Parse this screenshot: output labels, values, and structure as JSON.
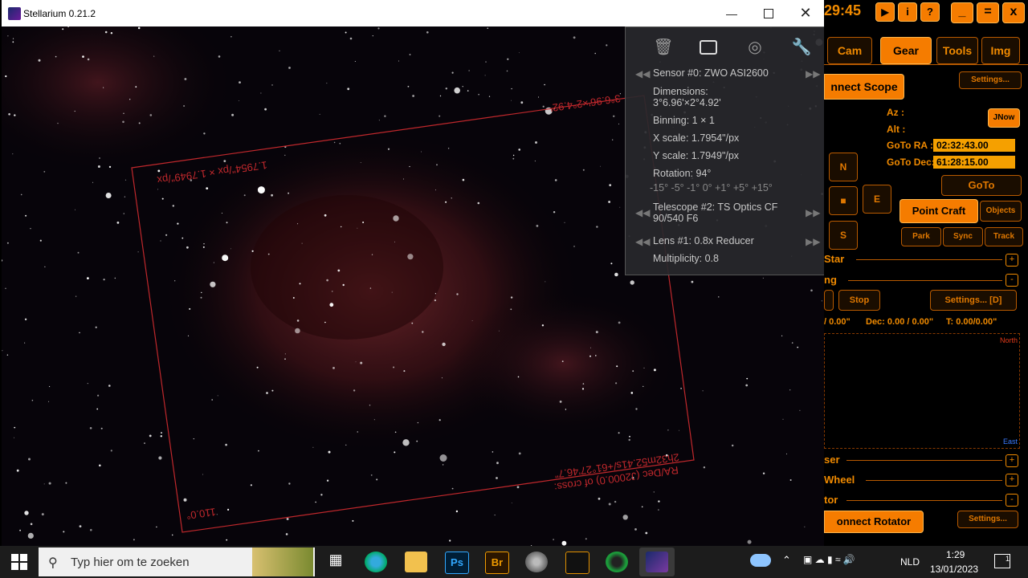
{
  "window": {
    "title": "Stellarium 0.21.2",
    "minimize_icon": "minimize-icon",
    "maximize_icon": "maximize-icon",
    "close_icon": "close-icon"
  },
  "overlay": {
    "scale_text": "1.7954\"/px × 1.7949\"/px",
    "dims_text": "3°6.96'×2°4.92'",
    "radec_text": "RA/Dec (J2000.0) of cross:",
    "radec_value": "2h32m52.41s/+61°27'46.7\"",
    "rotation_label": "110.0°"
  },
  "panel": {
    "tool_icons": [
      "trash-icon",
      "sensor-icon",
      "target-icon",
      "wrench-icon"
    ],
    "sensor": "Sensor #0: ZWO ASI2600",
    "dimensions_label": "Dimensions:",
    "dimensions_value": "3°6.96'×2°4.92'",
    "binning": "Binning: 1 × 1",
    "x_scale": "X scale: 1.7954\"/px",
    "y_scale": "Y scale: 1.7949\"/px",
    "rotation": "Rotation: 94°",
    "rotation_steps": "-15° -5° -1° 0° +1° +5° +15°",
    "telescope_line1": "Telescope #2: TS Optics CF",
    "telescope_line2": "90/540 F6",
    "lens": "Lens #1: 0.8x Reducer",
    "multiplicity": "Multiplicity: 0.8"
  },
  "nina": {
    "clock": "29:45",
    "top_icons": [
      "play-icon",
      "info-icon",
      "help-icon"
    ],
    "win_buttons": [
      "_",
      "=",
      "x"
    ],
    "tabs": [
      "Cam",
      "Gear",
      "Tools",
      "Img"
    ],
    "active_tab": "Gear",
    "connect_scope": "nnect Scope",
    "settings": "Settings...",
    "az": "Az :",
    "alt": "Alt :",
    "jnow": "JNow",
    "goto_ra_label": "GoTo RA :",
    "goto_ra_value": "02:32:43.00",
    "goto_dec_label": "GoTo Dec:",
    "goto_dec_value": "61:28:15.00",
    "goto": "GoTo",
    "dir_n": "N",
    "dir_e": "E",
    "dir_s": "S",
    "stop_center": "■",
    "point_craft": "Point Craft",
    "objects": "Objects",
    "park": "Park",
    "sync": "Sync",
    "track": "Track",
    "star": "Star",
    "guiding": "ng",
    "stop": "Stop",
    "settings_d": "Settings... [D]",
    "guide_ra": "/ 0.00\"",
    "guide_dec": "Dec: 0.00 / 0.00\"",
    "guide_t": "T: 0.00/0.00\"",
    "graph_north": "North",
    "graph_east": "East",
    "focuser": "ser",
    "filter_wheel": "Wheel",
    "rotator": "tor",
    "connect_rotator": "onnect Rotator",
    "settings2": "Settings..."
  },
  "taskbar": {
    "search_placeholder": "Typ hier om te zoeken",
    "language": "NLD",
    "time": "1:29",
    "date": "13/01/2023",
    "notifications": "1",
    "app_icons": [
      "task-view-icon",
      "edge-icon",
      "explorer-icon",
      "photoshop-icon",
      "bridge-icon",
      "app-icon",
      "app-icon",
      "app-icon",
      "stellarium-icon"
    ],
    "ps_label": "Ps",
    "br_label": "Br"
  }
}
